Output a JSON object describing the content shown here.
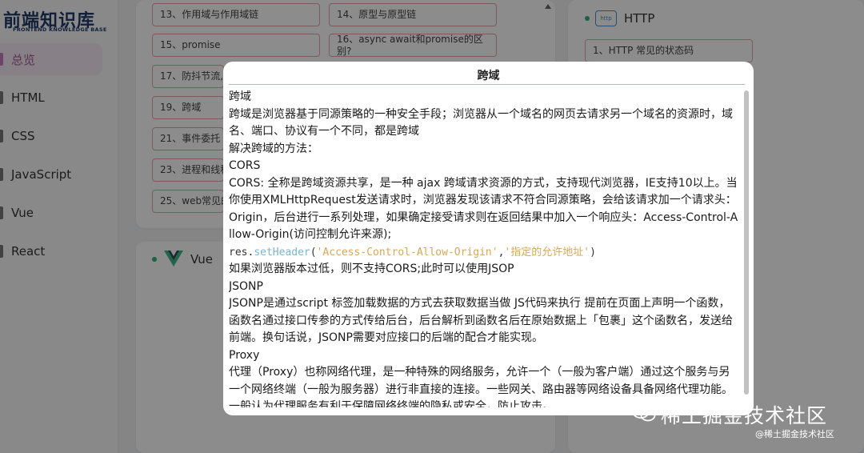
{
  "sidebar": {
    "logo_title": "前端知识库",
    "logo_subtitle": "FRONTEND KNOWLEDGE BASE",
    "items": [
      {
        "label": "总览",
        "active": true
      },
      {
        "label": "HTML"
      },
      {
        "label": "CSS"
      },
      {
        "label": "JavaScript"
      },
      {
        "label": "Vue"
      },
      {
        "label": "React"
      }
    ]
  },
  "js_card": {
    "items": [
      "13、作用域与作用域链",
      "14、原型与原型链",
      "15、promise",
      "16、async await和promise的区别?",
      "17、防抖节流,",
      "19、跨域",
      "21、事件委托",
      "23、进程和线程",
      "25、web常见的"
    ]
  },
  "vue_card": {
    "title": "Vue"
  },
  "http_card": {
    "title": "HTTP",
    "icon_label": "http",
    "items": [
      "1、HTTP 常见的状态码"
    ]
  },
  "modal": {
    "title": "跨域",
    "p1": "跨域",
    "p2": "跨域是浏览器基于同源策略的一种安全手段；浏览器从一个域名的网页去请求另一个域名的资源时，域名、端口、协议有一个不同，都是跨域",
    "p3": "解决跨域的方法：",
    "p4": "CORS",
    "p5": "CORS: 全称是跨域资源共享，是一种 ajax 跨域请求资源的方式，支持现代浏览器，IE支持10以上。当你使用XMLHttpRequest发送请求时，浏览器发现该请求不符合同源策略，会给该请求加一个请求头：Origin，后台进行一系列处理，如果确定接受请求则在返回结果中加入一个响应头：Access-Control-Allow-Origin(访问控制允许来源);",
    "code_var": "res.",
    "code_fn": "setHeader",
    "code_open": "(",
    "code_arg1": "'Access-Control-Allow-Origin'",
    "code_comma": ",",
    "code_arg2": "'指定的允许地址'",
    "code_close": ")",
    "p6": "如果浏览器版本过低，则不支持CORS;此时可以使用JSOP",
    "p7": "JSONP",
    "p8": "JSONP是通过script 标签加载数据的方式去获取数据当做 JS代码来执行 提前在页面上声明一个函数，函数名通过接口传参的方式传给后台，后台解析到函数名后在原始数据上「包裹」这个函数名，发送给前端。换句话说，JSONP需要对应接口的后端的配合才能实现。",
    "p9": "Proxy",
    "p10": "代理（Proxy）也称网络代理，是一种特殊的网络服务，允许一个（一般为客户端）通过这个服务与另一个网络终端（一般为服务器）进行非直接的连接。一些网关、路由器等网络设备具备网络代理功能。一般认为代理服务有利于保障网络终端的隐私或安全，防止攻击。"
  },
  "watermark": {
    "main": "稀土掘金技术社区",
    "sub": "@稀土掘金技术社区"
  }
}
